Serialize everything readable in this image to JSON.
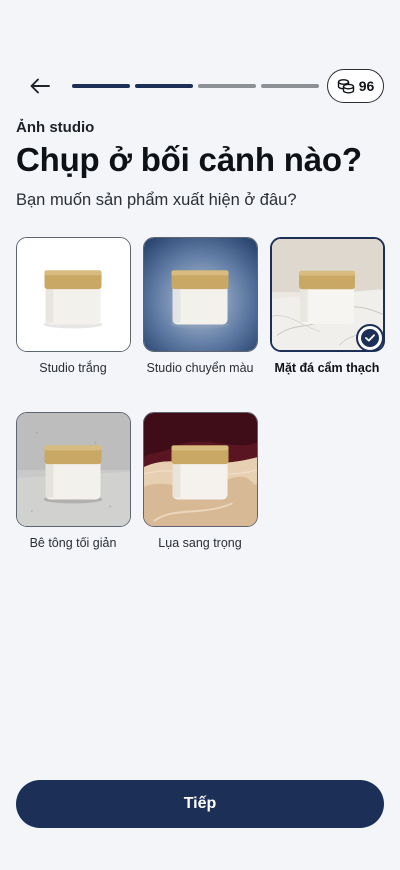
{
  "header": {
    "progress": {
      "total_steps": 4,
      "completed_steps": 2
    },
    "credits": {
      "icon": "coins-icon",
      "value": "96"
    }
  },
  "screen": {
    "eyebrow": "Ảnh studio",
    "title": "Chụp ở bối cảnh nào?",
    "subtitle": "Bạn muốn sản phẩm xuất hiện ở đâu?"
  },
  "options": [
    {
      "label": "Studio trắng",
      "selected": false
    },
    {
      "label": "Studio chuyển màu",
      "selected": false
    },
    {
      "label": "Mặt đá cẩm thạch",
      "selected": true
    },
    {
      "label": "Bê tông tối giản",
      "selected": false
    },
    {
      "label": "Lụa sang trọng",
      "selected": false
    }
  ],
  "footer": {
    "next_label": "Tiếp"
  },
  "colors": {
    "accent": "#1b2f57",
    "background": "#f3f5f8",
    "progress_inactive": "#8d9196",
    "jar_lid": "#c9a866",
    "jar_body": "#f3f1ec"
  }
}
